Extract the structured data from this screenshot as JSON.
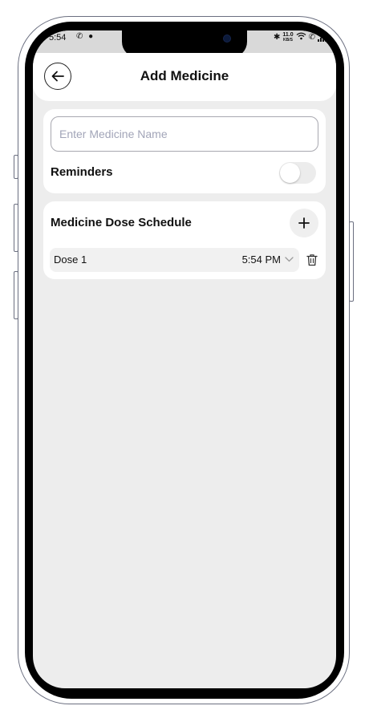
{
  "status_bar": {
    "time": "5:54",
    "left_icons": [
      "missed-call-icon",
      "whatsapp-icon"
    ],
    "right_icons": [
      "bluetooth-icon",
      "wifi-icon",
      "call-signal-icon",
      "signal-bars-icon",
      "battery-icon"
    ],
    "speed_value": "11.0",
    "speed_unit": "KB/S"
  },
  "header": {
    "title": "Add Medicine",
    "back_icon": "arrow-left-icon"
  },
  "medicine_form": {
    "name_placeholder": "Enter Medicine Name",
    "name_value": "",
    "reminders_label": "Reminders",
    "reminders_enabled": false
  },
  "schedule": {
    "title": "Medicine Dose Schedule",
    "add_icon": "plus-icon",
    "doses": [
      {
        "label": "Dose 1",
        "time": "5:54 PM",
        "dropdown_icon": "chevron-down-icon",
        "delete_icon": "trash-icon"
      }
    ]
  },
  "colors": {
    "screen_background": "#ededed",
    "card_background": "#ffffff",
    "status_bar_background": "#d9d9d9",
    "placeholder": "#a2a5b8",
    "toggle_off": "#ececec"
  }
}
